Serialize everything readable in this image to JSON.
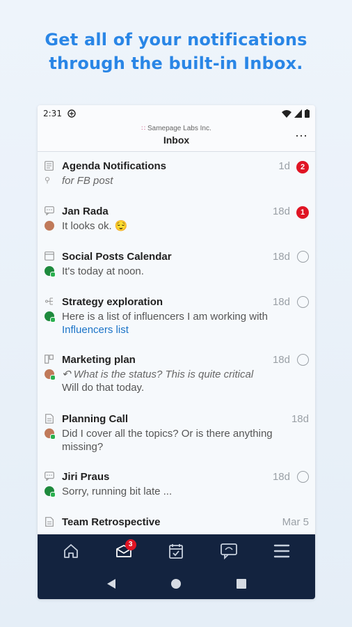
{
  "headline": {
    "line1": "Get all of your notifications",
    "line2": "through the built-in Inbox."
  },
  "status": {
    "time": "2:31"
  },
  "appbar": {
    "org": "Samepage Labs Inc.",
    "title": "Inbox",
    "more": "⋯"
  },
  "items": [
    {
      "title": "Agenda Notifications",
      "date": "1d",
      "badge": "2",
      "line1": "for FB post"
    },
    {
      "title": "Jan Rada",
      "date": "18d",
      "badge": "1",
      "line1": "It looks ok. 😌"
    },
    {
      "title": "Social Posts Calendar",
      "date": "18d",
      "line1": "It's today at noon."
    },
    {
      "title": "Strategy exploration",
      "date": "18d",
      "line1": "Here is a list of influencers I am working with",
      "link": "Influencers list"
    },
    {
      "title": "Marketing plan",
      "date": "18d",
      "line1": "What is the status? This is quite critical",
      "line2": "Will do that today."
    },
    {
      "title": "Planning Call",
      "date": "18d",
      "line1": "Did I cover all the topics? Or is there anything",
      "line2": "missing?"
    },
    {
      "title": "Jiri Praus",
      "date": "18d",
      "line1": "Sorry, running bit late ..."
    },
    {
      "title": "Team Retrospective",
      "date": "Mar 5"
    }
  ],
  "nav": {
    "inbox_badge": "3"
  },
  "colors": {
    "accent": "#2a86e6",
    "badge": "#e01524",
    "navbar": "#13233f",
    "link": "#1a73c7"
  }
}
